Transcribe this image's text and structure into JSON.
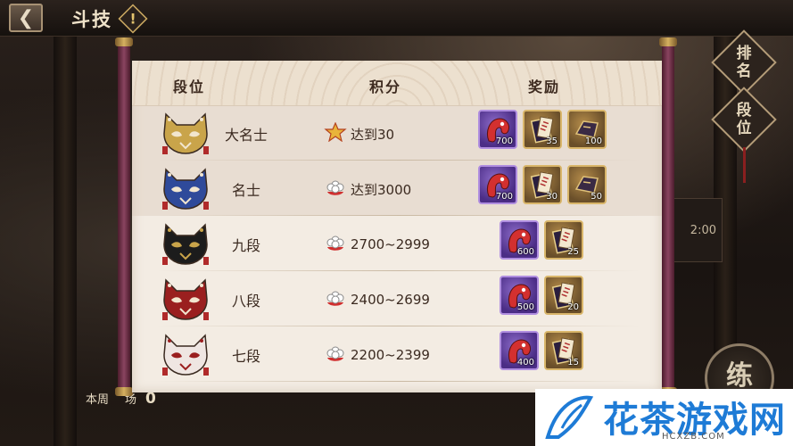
{
  "header": {
    "title": "斗技",
    "back_icon": "back-arrow-icon",
    "alert_icon": "warning-icon"
  },
  "side": {
    "ranking_label": [
      "排",
      "名"
    ],
    "rank_label": [
      "段",
      "位"
    ]
  },
  "table": {
    "columns": [
      "段位",
      "积分",
      "奖励"
    ],
    "rows": [
      {
        "rank": "大名士",
        "mask_color": "#c9a44a",
        "score_icon": "star-rank-icon",
        "score": "达到30",
        "rewards": [
          {
            "type": "purple",
            "icon": "red-daruma-icon",
            "qty": "700"
          },
          {
            "type": "gold",
            "icon": "scroll-icon",
            "qty": "35"
          },
          {
            "type": "gold",
            "icon": "mask-fragment-icon",
            "qty": "100"
          }
        ]
      },
      {
        "rank": "名士",
        "mask_color": "#2f4a9a",
        "score_icon": "flower-icon",
        "score": "达到3000",
        "rewards": [
          {
            "type": "purple",
            "icon": "red-daruma-icon",
            "qty": "700"
          },
          {
            "type": "gold",
            "icon": "scroll-icon",
            "qty": "30"
          },
          {
            "type": "gold",
            "icon": "mask-fragment-icon",
            "qty": "50"
          }
        ]
      },
      {
        "rank": "九段",
        "mask_color": "#1c1c1c",
        "score_icon": "flower-icon",
        "score": "2700~2999",
        "rewards": [
          {
            "type": "purple",
            "icon": "red-daruma-icon",
            "qty": "600"
          },
          {
            "type": "gold",
            "icon": "scroll-icon",
            "qty": "25"
          }
        ]
      },
      {
        "rank": "八段",
        "mask_color": "#9a1f1f",
        "score_icon": "flower-icon",
        "score": "2400~2699",
        "rewards": [
          {
            "type": "purple",
            "icon": "red-daruma-icon",
            "qty": "500"
          },
          {
            "type": "gold",
            "icon": "scroll-icon",
            "qty": "20"
          }
        ]
      },
      {
        "rank": "七段",
        "mask_color": "#efe6e2",
        "score_icon": "flower-icon",
        "score": "2200~2399",
        "rewards": [
          {
            "type": "purple",
            "icon": "red-daruma-icon",
            "qty": "400"
          },
          {
            "type": "gold",
            "icon": "scroll-icon",
            "qty": "15"
          }
        ]
      }
    ]
  },
  "footer": {
    "weekly_label": "本周",
    "weekly_suffix": "场",
    "weekly_value": "0",
    "practice_label": "练",
    "clock_text": "2:00"
  },
  "watermark": {
    "text": "花茶游戏网",
    "url": "HCXZB.COM"
  }
}
